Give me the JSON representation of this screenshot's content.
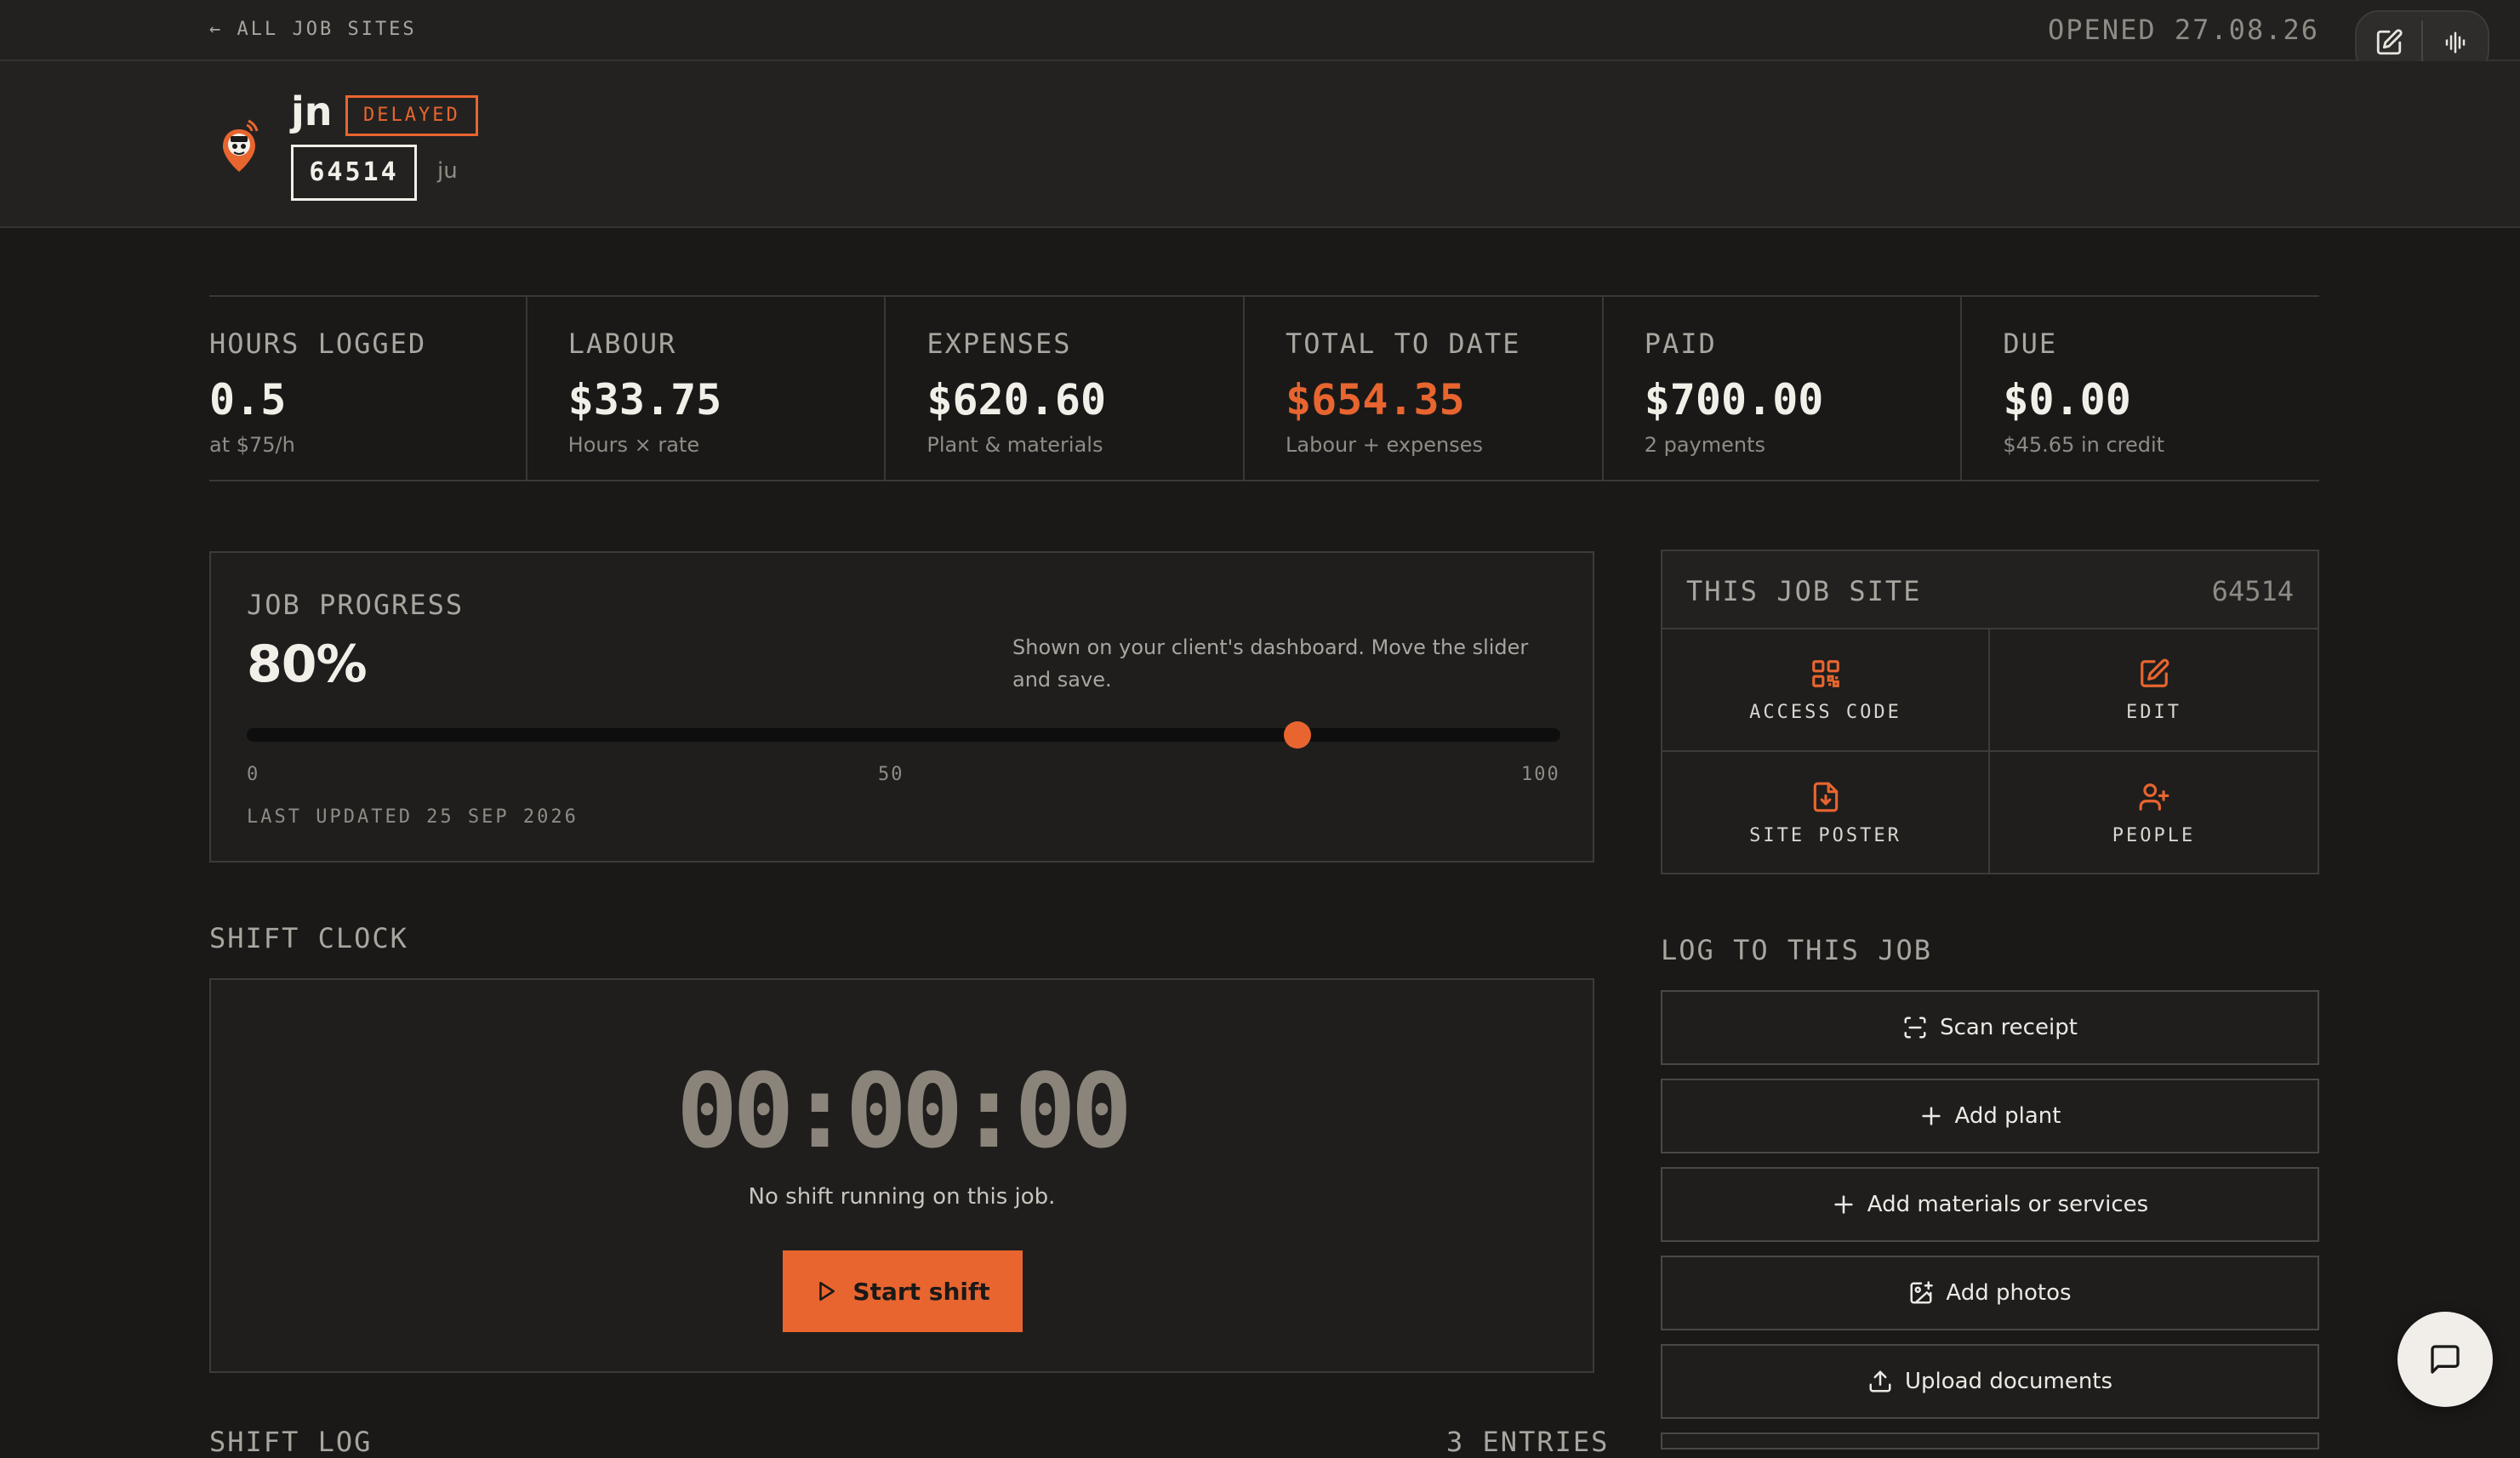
{
  "topbar": {
    "back_label": "← ALL JOB SITES",
    "opened": "OPENED 27.08.26"
  },
  "header": {
    "name": "jn",
    "status": "DELAYED",
    "code": "64514",
    "client": "ju"
  },
  "stats": [
    {
      "label": "HOURS LOGGED",
      "value": "0.5",
      "sub": "at $75/h"
    },
    {
      "label": "LABOUR",
      "value": "$33.75",
      "sub": "Hours × rate"
    },
    {
      "label": "EXPENSES",
      "value": "$620.60",
      "sub": "Plant & materials"
    },
    {
      "label": "TOTAL TO DATE",
      "value": "$654.35",
      "sub": "Labour + expenses"
    },
    {
      "label": "PAID",
      "value": "$700.00",
      "sub": "2 payments"
    },
    {
      "label": "DUE",
      "value": "$0.00",
      "sub": "$45.65 in credit"
    }
  ],
  "progress": {
    "label": "JOB PROGRESS",
    "value_text": "80%",
    "value": 80,
    "note": "Shown on your client's dashboard. Move the slider and save.",
    "tick_min": "0",
    "tick_mid": "50",
    "tick_max": "100",
    "updated": "LAST UPDATED 25 SEP 2026"
  },
  "shift": {
    "title": "SHIFT CLOCK",
    "time": "00:00:00",
    "status": "No shift running on this job.",
    "start_label": "Start shift"
  },
  "shift_log": {
    "title": "SHIFT LOG",
    "entries": "3 ENTRIES"
  },
  "site_panel": {
    "title": "THIS JOB SITE",
    "code": "64514",
    "actions": {
      "access": "ACCESS CODE",
      "edit": "EDIT",
      "poster": "SITE POSTER",
      "people": "PEOPLE"
    }
  },
  "log": {
    "title": "LOG TO THIS JOB",
    "scan": "Scan receipt",
    "plant": "Add plant",
    "materials": "Add materials or services",
    "photos": "Add photos",
    "documents": "Upload documents"
  },
  "colors": {
    "accent": "#e8652f",
    "background": "#1a1918",
    "panel": "#1f1e1d"
  },
  "icons": [
    "edit-icon",
    "voice-icon",
    "qr-code-icon",
    "file-download-icon",
    "user-plus-icon",
    "scan-icon",
    "plus-icon",
    "image-plus-icon",
    "upload-icon",
    "play-icon",
    "chat-icon"
  ]
}
